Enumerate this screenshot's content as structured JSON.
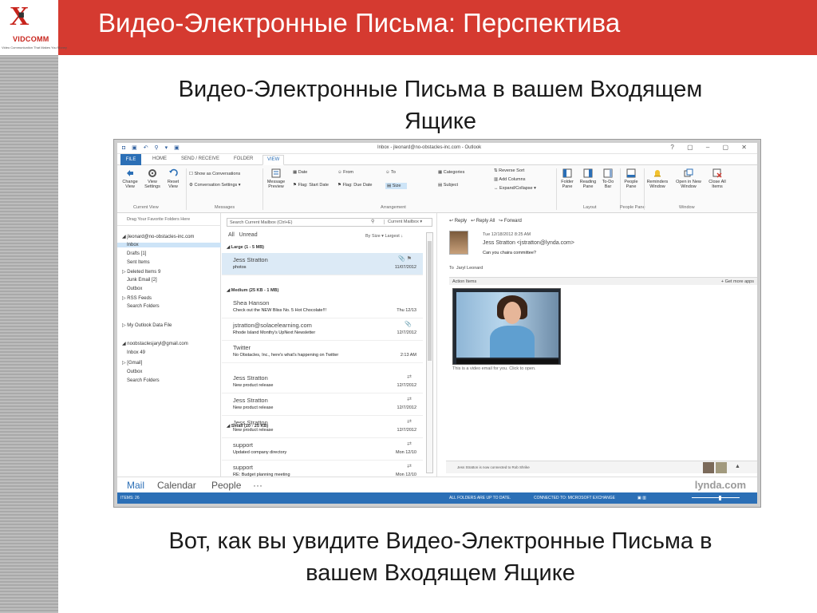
{
  "slide": {
    "title": "Видео-Электронные Письма: Перспектива",
    "heading_line1": "Видео-Электронные Письма в вашем Входящем",
    "heading_line2": "Ящике",
    "caption_line1": "Вот, как вы увидите Видео-Электронные Письма в",
    "caption_line2": "вашем Входящем Ящике",
    "logo": {
      "brand": "VIDCOMM",
      "tagline": "Video Communication That Makes You Money"
    },
    "colors": {
      "title_bar": "#d53a30",
      "accent_blue": "#2b6fb6"
    }
  },
  "outlook": {
    "window_title": "Inbox - jleonard@no-obstacles-inc.com - Outlook",
    "window_controls": "? ▢ – ▢ ✕",
    "tabs": [
      "FILE",
      "HOME",
      "SEND / RECEIVE",
      "FOLDER",
      "VIEW"
    ],
    "active_tab": "VIEW",
    "ribbon": {
      "change_view": "Change View",
      "view_settings": "View Settings",
      "reset_view": "Reset View",
      "show_as_conversations": "Show as Conversations",
      "conversation_settings": "Conversation Settings",
      "message_preview": "Message Preview",
      "sort_date": "Date",
      "sort_from": "From",
      "sort_to": "To",
      "sort_categories": "Categories",
      "flag_start": "Flag: Start Date",
      "flag_due": "Flag: Due Date",
      "sort_size": "Size",
      "sort_subject": "Subject",
      "reverse_sort": "Reverse Sort",
      "add_columns": "Add Columns",
      "expand_collapse": "Expand/Collapse",
      "folder_pane": "Folder Pane",
      "reading_pane": "Reading Pane",
      "todo_bar": "To-Do Bar",
      "people_pane": "People Pane",
      "reminders": "Reminders Window",
      "open_new_window": "Open in New Window",
      "close_all": "Close All Items",
      "groups": [
        "Current View",
        "Messages",
        "Arrangement",
        "Layout",
        "People Pane",
        "Window"
      ]
    },
    "folders": {
      "favorites_hint": "Drag Your Favorite Folders Here",
      "items": [
        {
          "label": "◢ jleonard@no-obstacles-inc.com",
          "selected": false
        },
        {
          "label": "Inbox",
          "selected": true
        },
        {
          "label": "Drafts [1]",
          "selected": false
        },
        {
          "label": "Sent Items",
          "selected": false
        },
        {
          "label": "▷ Deleted Items 9",
          "selected": false
        },
        {
          "label": "Junk Email [2]",
          "selected": false
        },
        {
          "label": "Outbox",
          "selected": false
        },
        {
          "label": "▷ RSS Feeds",
          "selected": false
        },
        {
          "label": "Search Folders",
          "selected": false
        },
        {
          "label": "▷ My Outlook Data File",
          "selected": false
        },
        {
          "label": "◢ noobstaclesjaryl@gmail.com",
          "selected": false
        },
        {
          "label": "Inbox 49",
          "selected": false
        },
        {
          "label": "▷ [Gmail]",
          "selected": false
        },
        {
          "label": "Outbox",
          "selected": false
        },
        {
          "label": "Search Folders",
          "selected": false
        }
      ]
    },
    "message_list": {
      "search_placeholder": "Search Current Mailbox (Ctrl+E)",
      "scope": "Current Mailbox",
      "filter_all": "All",
      "filter_unread": "Unread",
      "sort_label": "By Size ▾    Largest ↓",
      "groups": [
        {
          "label": "◢ Large (1 - 5 MB)"
        },
        {
          "label": "◢ Medium (25 KB - 1 MB)"
        },
        {
          "label": "◢ Small (10 - 25 KB)"
        }
      ],
      "messages": [
        {
          "from": "Jess Stratton",
          "subject": "photos",
          "date": "11/07/2012",
          "icon": "📎 ⚑",
          "selected": true
        },
        {
          "from": "Shea Hanson",
          "subject": "Check out the NEW Bliss No. 5 Hot Chocolate!!!",
          "date": "Thu 12/13",
          "icon": "",
          "selected": false
        },
        {
          "from": "jstratton@solacelearning.com",
          "subject": "Rhode Island Monthy's UpNext Newsletter",
          "date": "12/7/2012",
          "icon": "📎",
          "selected": false
        },
        {
          "from": "Twitter",
          "subject": "No Obstacles, Inc., here's what's happening on Twitter",
          "date": "2:13 AM",
          "icon": "",
          "selected": false
        },
        {
          "from": "Jess Stratton",
          "subject": "New product release",
          "date": "12/7/2012",
          "icon": "⇄",
          "selected": false
        },
        {
          "from": "Jess Stratton",
          "subject": "New product release",
          "date": "12/7/2012",
          "icon": "⇄",
          "selected": false
        },
        {
          "from": "Jess Stratton",
          "subject": "New product release",
          "date": "12/7/2012",
          "icon": "⇄",
          "selected": false
        },
        {
          "from": "support",
          "subject": "Updated company directory",
          "date": "Mon 12/10",
          "icon": "⇄",
          "selected": false
        },
        {
          "from": "support",
          "subject": "RE: Budget planning meeting",
          "date": "Mon 12/10",
          "icon": "⇄",
          "selected": false
        }
      ]
    },
    "reading_pane": {
      "reply": "Reply",
      "reply_all": "Reply All",
      "forward": "Forward",
      "date": "Tue 12/18/2012 8:25 AM",
      "sender": "Jess Stratton <jstratton@lynda.com>",
      "subject": "Can you chaira committee?",
      "to_label": "To",
      "to_value": "Jaryl Leonard",
      "action_items": "Action Items",
      "get_more_apps": "+ Get more apps",
      "body": "This is a video email for you. Click to open.",
      "people_status": "Jess Stratton is now connected to Rob Shrike"
    },
    "nav": [
      "Mail",
      "Calendar",
      "People",
      "···"
    ],
    "watermark": "lynda.com",
    "status": {
      "items": "ITEMS: 26",
      "folders": "ALL FOLDERS ARE UP TO DATE.",
      "connection": "CONNECTED TO: MICROSOFT EXCHANGE"
    }
  }
}
